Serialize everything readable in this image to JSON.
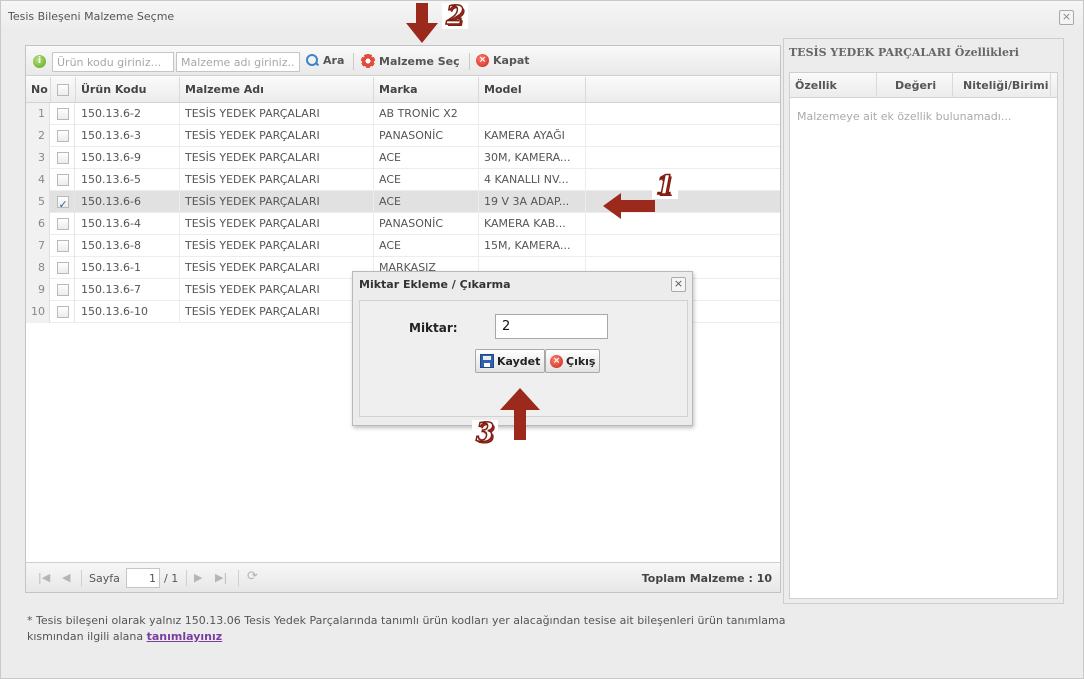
{
  "window": {
    "title": "Tesis Bileşeni Malzeme Seçme",
    "close_label": "×"
  },
  "toolbar": {
    "code_placeholder": "Ürün kodu giriniz...",
    "name_placeholder": "Malzeme adı giriniz...",
    "search_label": "Ara",
    "select_label": "Malzeme Seç",
    "close_label": "Kapat"
  },
  "grid": {
    "columns": [
      "No",
      "Ürün Kodu",
      "Malzeme Adı",
      "Marka",
      "Model"
    ],
    "rows": [
      {
        "no": "1",
        "kod": "150.13.6-2",
        "ad": "TESİS YEDEK PARÇALARI",
        "marka": "AB TRONİC X2",
        "model": "",
        "checked": false
      },
      {
        "no": "2",
        "kod": "150.13.6-3",
        "ad": "TESİS YEDEK PARÇALARI",
        "marka": "PANASONİC",
        "model": "KAMERA AYAĞI",
        "checked": false
      },
      {
        "no": "3",
        "kod": "150.13.6-9",
        "ad": "TESİS YEDEK PARÇALARI",
        "marka": "ACE",
        "model": "30M, KAMERA...",
        "checked": false
      },
      {
        "no": "4",
        "kod": "150.13.6-5",
        "ad": "TESİS YEDEK PARÇALARI",
        "marka": "ACE",
        "model": "4 KANALLI NV...",
        "checked": false
      },
      {
        "no": "5",
        "kod": "150.13.6-6",
        "ad": "TESİS YEDEK PARÇALARI",
        "marka": "ACE",
        "model": "19 V 3A ADAP...",
        "checked": true
      },
      {
        "no": "6",
        "kod": "150.13.6-4",
        "ad": "TESİS YEDEK PARÇALARI",
        "marka": "PANASONİC",
        "model": "KAMERA KAB...",
        "checked": false
      },
      {
        "no": "7",
        "kod": "150.13.6-8",
        "ad": "TESİS YEDEK PARÇALARI",
        "marka": "ACE",
        "model": "15M, KAMERA...",
        "checked": false
      },
      {
        "no": "8",
        "kod": "150.13.6-1",
        "ad": "TESİS YEDEK PARÇALARI",
        "marka": "MARKASIZ",
        "model": "",
        "checked": false
      },
      {
        "no": "9",
        "kod": "150.13.6-7",
        "ad": "TESİS YEDEK PARÇALARI",
        "marka": "",
        "model": "",
        "checked": false
      },
      {
        "no": "10",
        "kod": "150.13.6-10",
        "ad": "TESİS YEDEK PARÇALARI",
        "marka": "",
        "model": "",
        "checked": false
      }
    ]
  },
  "pager": {
    "first": "|◀",
    "prev": "◀",
    "page_label": "Sayfa",
    "page_value": "1",
    "page_total": "/ 1",
    "next": "▶",
    "last": "▶|",
    "refresh": "⟳",
    "total_label": "Toplam Malzeme : 10"
  },
  "right_panel": {
    "title": "TESİS YEDEK PARÇALARI Özellikleri",
    "columns": [
      "Özellik",
      "Değeri",
      "Niteliği/Birimi"
    ],
    "empty_text": "Malzemeye ait ek özellik bulunamadı..."
  },
  "footnote": {
    "text": "* Tesis bileşeni olarak yalnız 150.13.06 Tesis Yedek Parçalarında tanımlı ürün kodları yer alacağından tesise ait bileşenleri ürün tanımlama kısmından ilgili alana",
    "link": "tanımlayınız"
  },
  "dialog": {
    "title": "Miktar Ekleme / Çıkarma",
    "close_label": "×",
    "label": "Miktar:",
    "value": "2",
    "save_label": "Kaydet",
    "exit_label": "Çıkış"
  },
  "annotations": {
    "step1": "1",
    "step2": "2",
    "step3": "3",
    "arrow_color": "#9b2a1c"
  }
}
